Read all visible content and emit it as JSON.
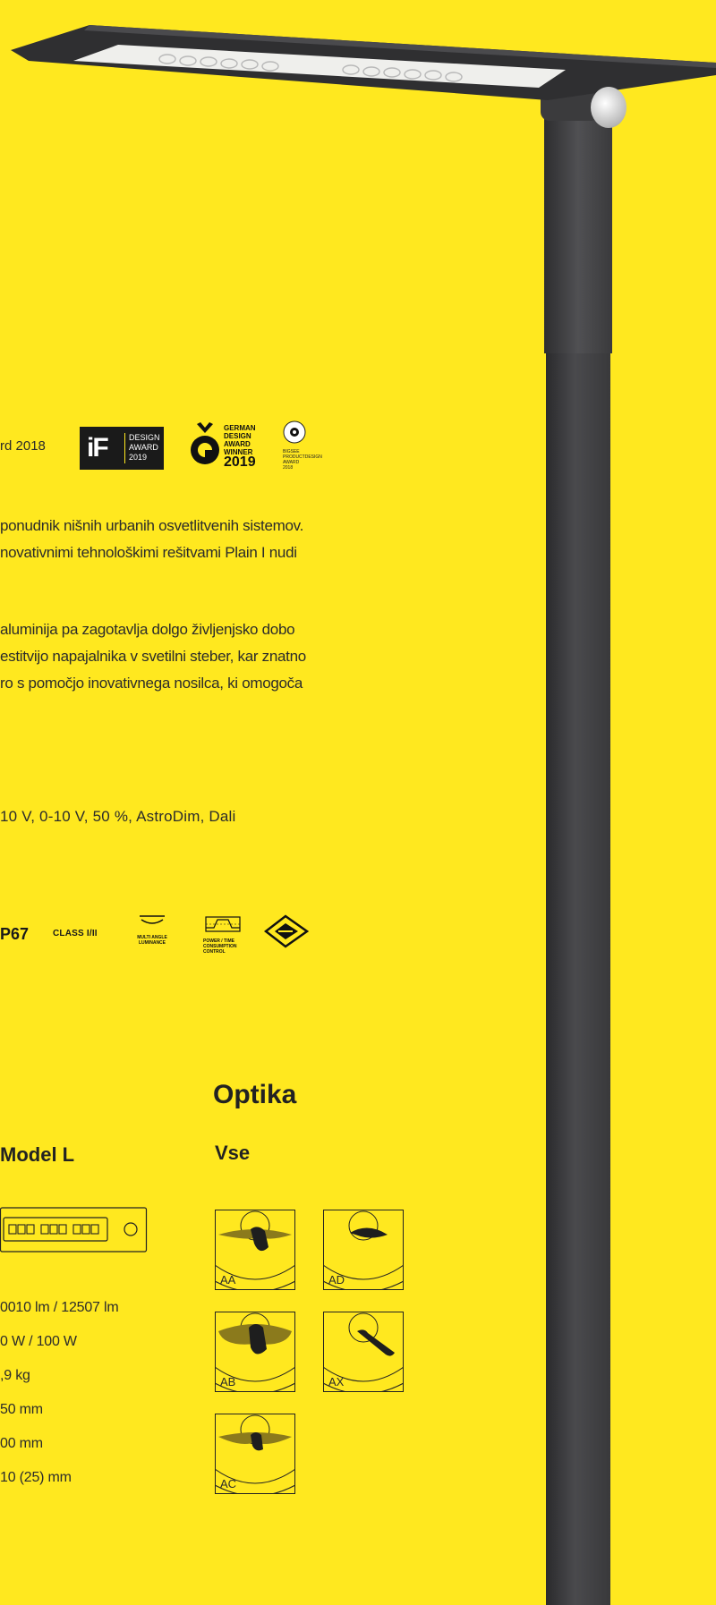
{
  "awards": {
    "text": "rd 2018",
    "if_mark": "iF",
    "if_lines": [
      "DESIGN",
      "AWARD",
      "2019"
    ],
    "german_lines": [
      "GERMAN",
      "DESIGN",
      "AWARD",
      "WINNER"
    ],
    "german_year": "2019",
    "bigsee_lines": [
      "BIGSEE",
      "PRODUCTDESIGN",
      "AWARD",
      "2018"
    ]
  },
  "paragraphs": {
    "p1": [
      "ponudnik nišnih urbanih osvetlitvenih sistemov.",
      "novativnimi tehnološkimi rešitvami Plain I nudi"
    ],
    "p2": [
      "aluminija pa zagotavlja dolgo življenjsko dobo",
      "estitvijo napajalnika v svetilni steber, kar znatno",
      "ro s pomočjo inovativnega nosilca, ki omogoča"
    ]
  },
  "dimming": "10 V, 0-10 V, 50 %, AstroDim, Dali",
  "certifications": {
    "ip": "P67",
    "class": "CLASS I/II",
    "multi_angle": [
      "MULTI ANGLE",
      "LUMINANCE"
    ],
    "power": [
      "POWER / TIME",
      "CONSUMPTION",
      "CONTROL"
    ],
    "eac_icon": "eac-icon"
  },
  "headings": {
    "optika": "Optika",
    "model": "Model L",
    "vse": "Vse"
  },
  "specs": [
    "0010 lm  /  12507 lm",
    "0 W  /  100 W",
    ",9 kg",
    "50 mm",
    "00 mm",
    "10 (25) mm"
  ],
  "optics": [
    {
      "label": "AA"
    },
    {
      "label": "AD"
    },
    {
      "label": "AB"
    },
    {
      "label": "AX"
    },
    {
      "label": "AC"
    }
  ],
  "colors": {
    "background": "#ffe81f",
    "pole": "#3a3a3c",
    "text": "#2b2b2b"
  }
}
